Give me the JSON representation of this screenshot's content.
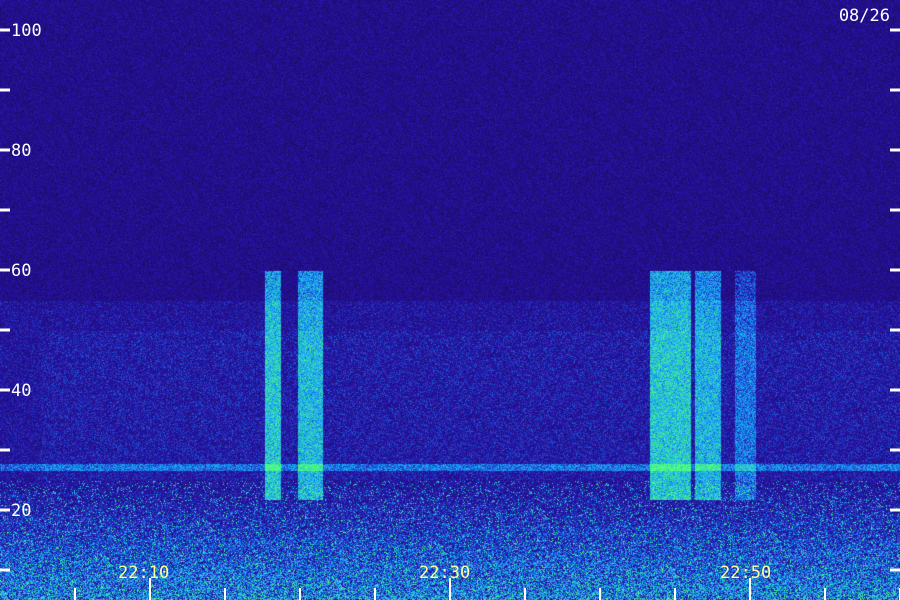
{
  "chart_data": {
    "type": "heatmap",
    "title": "",
    "xlabel": "",
    "ylabel": "",
    "date": "08/26",
    "y_ticks": [
      {
        "value": 100,
        "label": "100"
      },
      {
        "value": 90,
        "label": ""
      },
      {
        "value": 80,
        "label": "80"
      },
      {
        "value": 70,
        "label": ""
      },
      {
        "value": 60,
        "label": "60"
      },
      {
        "value": 50,
        "label": ""
      },
      {
        "value": 40,
        "label": "40"
      },
      {
        "value": 30,
        "label": ""
      },
      {
        "value": 20,
        "label": "20"
      },
      {
        "value": 10,
        "label": ""
      }
    ],
    "ylim": [
      0,
      105
    ],
    "x_time_labels": [
      "22:10",
      "22:30",
      "22:50"
    ],
    "colormap": [
      "#1a0a4a",
      "#2a1a9a",
      "#2a4aff",
      "#22c8ff",
      "#40ff80"
    ],
    "colors": {
      "background": "#1e0e55",
      "tick": "#ffffff",
      "time_label": "#ffff99",
      "date_label": "#ffffff"
    }
  }
}
